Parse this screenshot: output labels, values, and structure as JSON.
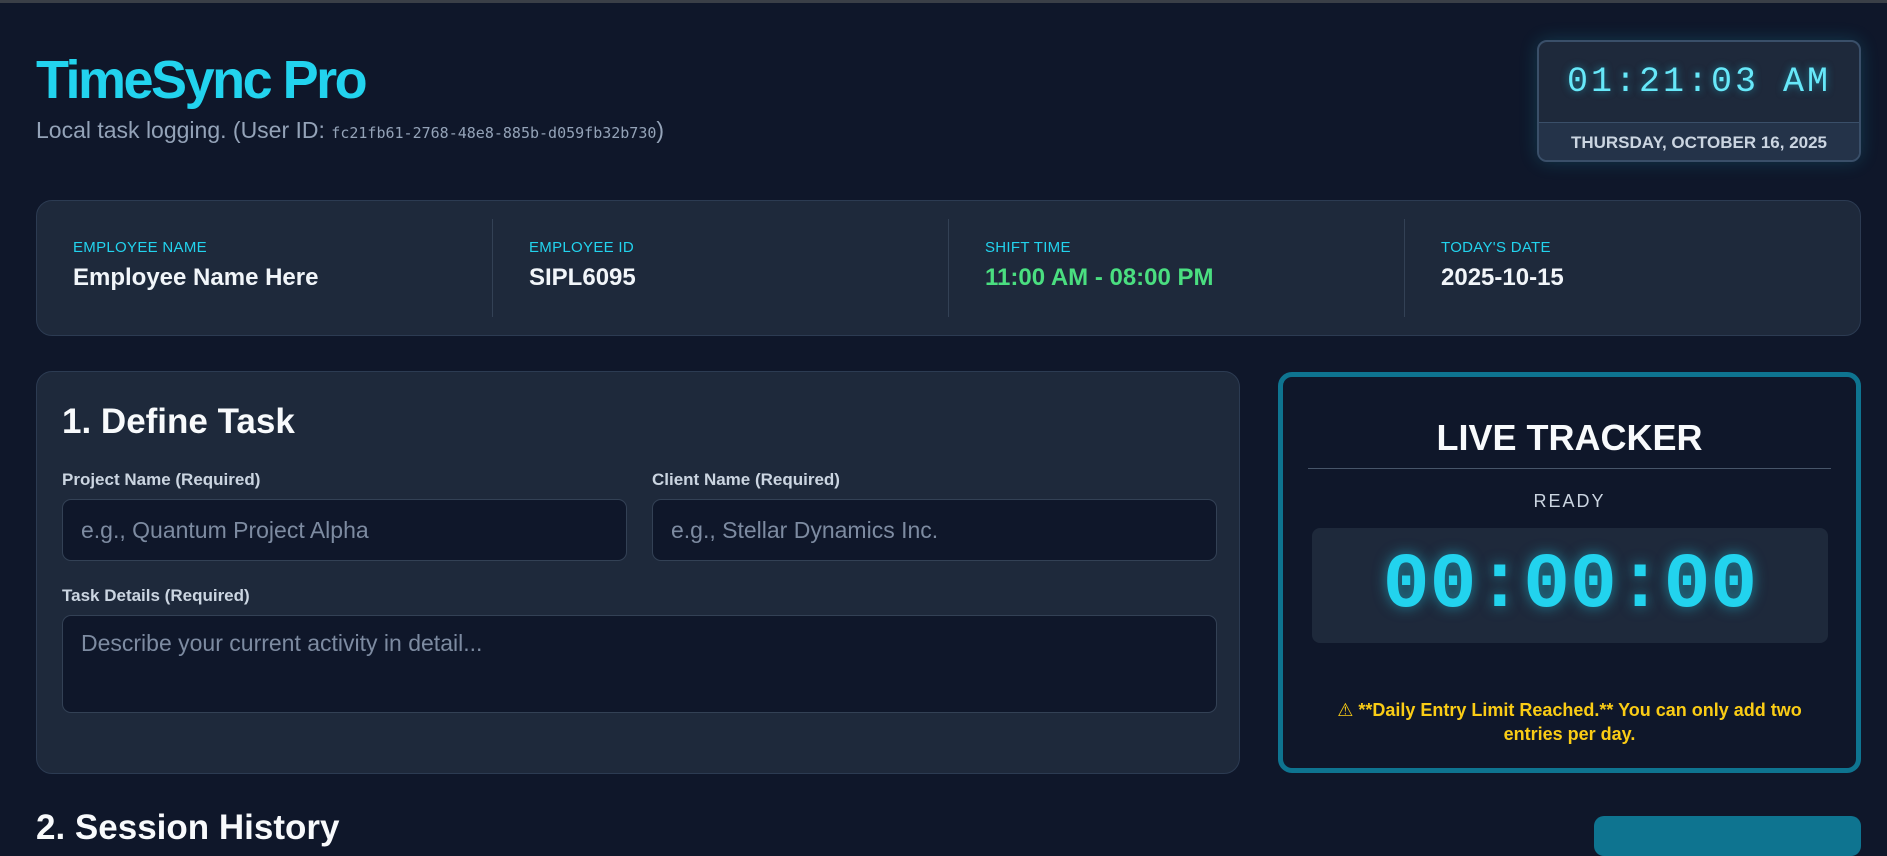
{
  "app": {
    "title": "TimeSync Pro",
    "subtitle_prefix": "Local task logging. (User ID: ",
    "user_id": "fc21fb61-2768-48e8-885b-d059fb32b730",
    "subtitle_suffix": ")"
  },
  "clock": {
    "time": "01:21:03 AM",
    "date": "THURSDAY, OCTOBER 16, 2025"
  },
  "employee": {
    "name_label": "EMPLOYEE NAME",
    "name_value": "Employee Name Here",
    "id_label": "EMPLOYEE ID",
    "id_value": "SIPL6095",
    "shift_label": "SHIFT TIME",
    "shift_value": "11:00 AM - 08:00 PM",
    "date_label": "TODAY'S DATE",
    "date_value": "2025-10-15"
  },
  "task_form": {
    "title": "1. Define Task",
    "project_label": "Project Name (Required)",
    "project_placeholder": "e.g., Quantum Project Alpha",
    "project_value": "",
    "client_label": "Client Name (Required)",
    "client_placeholder": "e.g., Stellar Dynamics Inc.",
    "client_value": "",
    "details_label": "Task Details (Required)",
    "details_placeholder": "Describe your current activity in detail...",
    "details_value": ""
  },
  "tracker": {
    "title": "LIVE TRACKER",
    "status": "READY",
    "timer": "00:00:00",
    "warning": "⚠ **Daily Entry Limit Reached.** You can only add two entries per day."
  },
  "history": {
    "title": "2. Session History"
  },
  "colors": {
    "background": "#0f172a",
    "panel": "#1e293b",
    "accent": "#22d3ee",
    "tracker_border": "#0e7490",
    "shift_green": "#4ade80",
    "warning_yellow": "#facc15"
  }
}
